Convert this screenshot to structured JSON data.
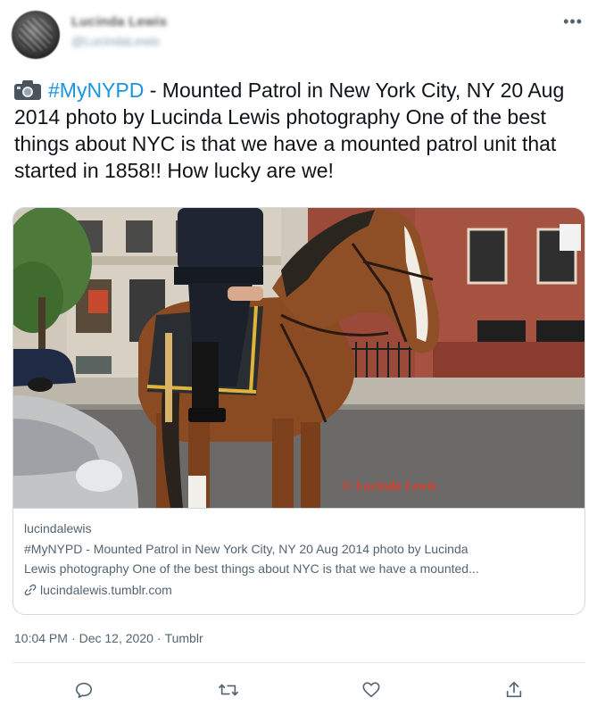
{
  "author": {
    "name": "Lucinda Lewis",
    "handle": "@LucindaLewis"
  },
  "more_label": "•••",
  "tweet": {
    "icon": "camera-icon",
    "hashtag": "#MyNYPD",
    "body": " - Mounted Patrol in New York City, NY 20 Aug 2014 photo by Lucinda Lewis photography One of the best things about NYC is that we have a mounted patrol unit that started in 1858!! How lucky are we!"
  },
  "card": {
    "photo_watermark": "© Lucinda Lewis",
    "domain": "lucindalewis",
    "description_line1": "#MyNYPD - Mounted Patrol in New York City, NY 20 Aug 2014 photo by Lucinda",
    "description_line2": "Lewis photography One of the best things about NYC is that we have a mounted...",
    "link_icon": "link-icon",
    "link_text": "lucindalewis.tumblr.com"
  },
  "meta": {
    "time": "10:04 PM",
    "date": "Dec 12, 2020",
    "source": "Tumblr",
    "separator": "·"
  },
  "actions": {
    "reply_icon": "reply-icon",
    "retweet_icon": "retweet-icon",
    "like_icon": "heart-icon",
    "share_icon": "share-icon"
  },
  "colors": {
    "link_blue": "#1b95e0",
    "secondary_text": "#536471",
    "border": "#cfd9de"
  }
}
